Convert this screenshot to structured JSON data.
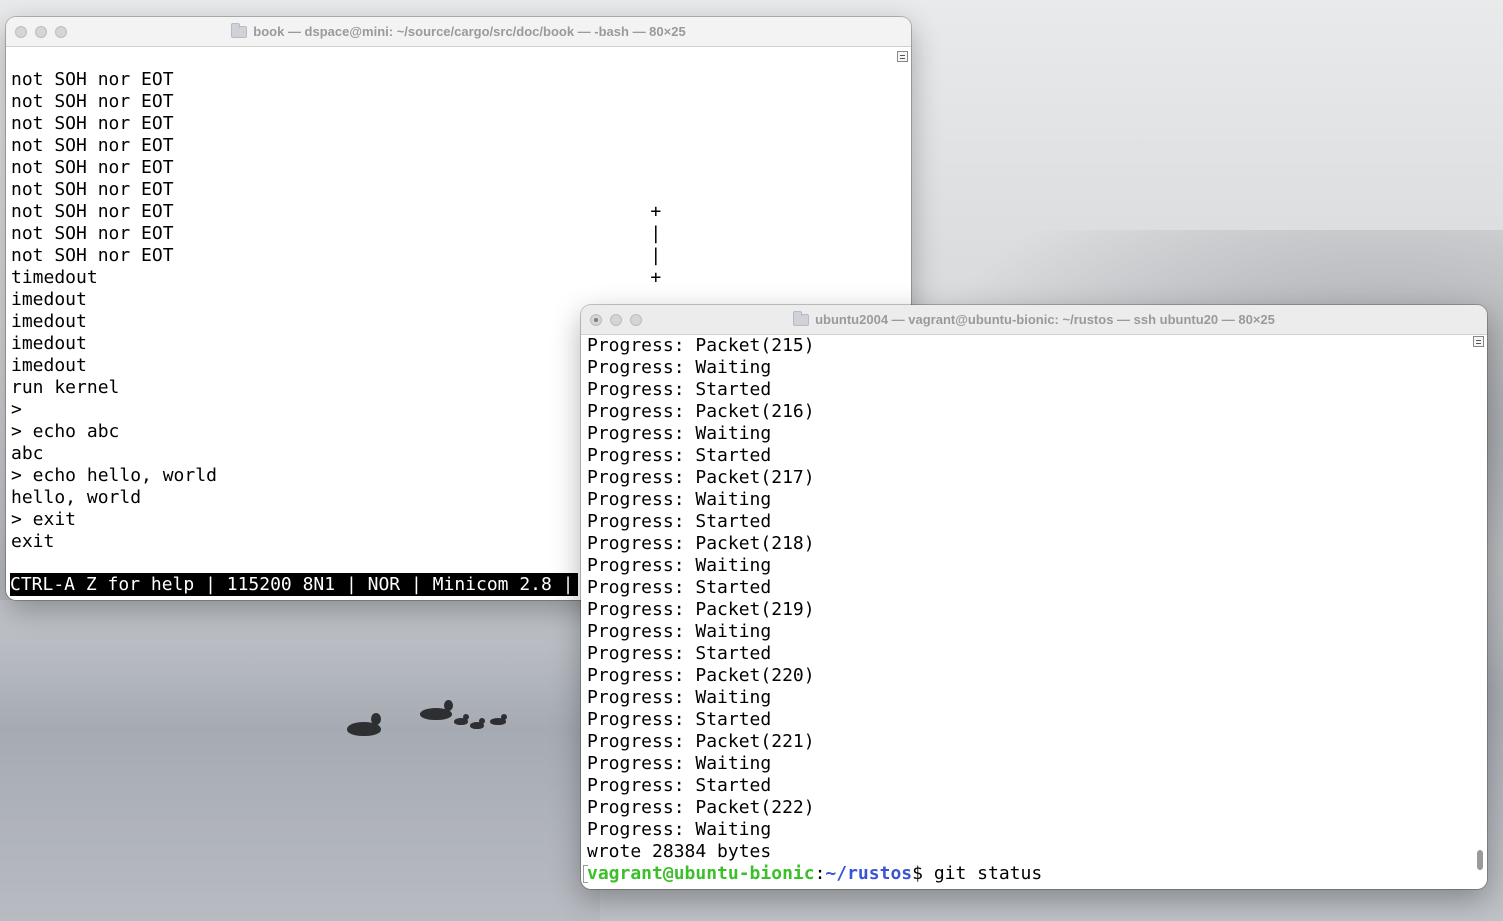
{
  "window_left": {
    "title": "book — dspace@mini: ~/source/cargo/src/doc/book — -bash — 80×25",
    "lines": [
      "",
      "not SOH nor EOT",
      "not SOH nor EOT",
      "not SOH nor EOT",
      "not SOH nor EOT",
      "not SOH nor EOT",
      "not SOH nor EOT",
      "not SOH nor EOT                                            +",
      "not SOH nor EOT                                            |",
      "not SOH nor EOT                                            |",
      "timedout                                                   +",
      "imedout",
      "imedout",
      "imedout",
      "imedout",
      "run kernel",
      ">",
      "> echo abc",
      "abc",
      "> echo hello, world",
      "hello, world",
      "> exit",
      "exit"
    ],
    "status_bar": "CTRL-A Z for help | 115200 8N1 | NOR | Minicom 2.8 |"
  },
  "window_right": {
    "title": "ubuntu2004 — vagrant@ubuntu-bionic: ~/rustos — ssh ubuntu20 — 80×25",
    "lines": [
      "Progress: Packet(215)",
      "Progress: Waiting",
      "Progress: Started",
      "Progress: Packet(216)",
      "Progress: Waiting",
      "Progress: Started",
      "Progress: Packet(217)",
      "Progress: Waiting",
      "Progress: Started",
      "Progress: Packet(218)",
      "Progress: Waiting",
      "Progress: Started",
      "Progress: Packet(219)",
      "Progress: Waiting",
      "Progress: Started",
      "Progress: Packet(220)",
      "Progress: Waiting",
      "Progress: Started",
      "Progress: Packet(221)",
      "Progress: Waiting",
      "Progress: Started",
      "Progress: Packet(222)",
      "Progress: Waiting",
      "wrote 28384 bytes"
    ],
    "prompt": {
      "user_host": "vagrant@ubuntu-bionic",
      "separator": ":",
      "path": "~/rustos",
      "symbol": "$ ",
      "command": "git status"
    }
  },
  "colors": {
    "prompt_user": "#3cbf2a",
    "prompt_path": "#3a55d4",
    "status_bar_bg": "#000000"
  }
}
